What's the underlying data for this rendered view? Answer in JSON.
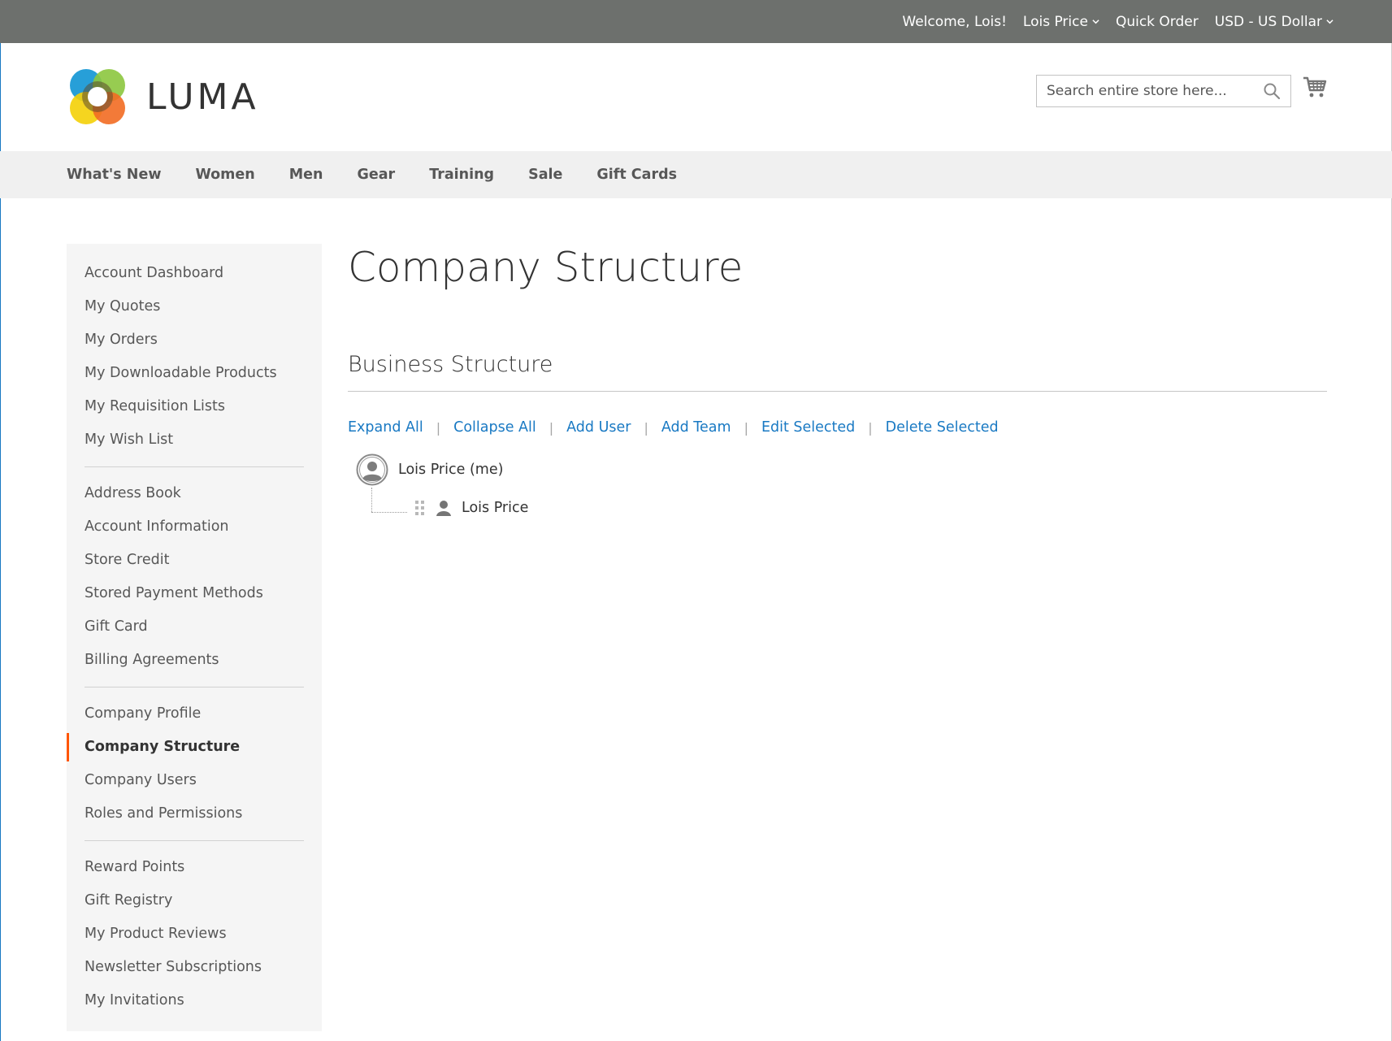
{
  "top_bar": {
    "welcome": "Welcome, Lois!",
    "account_menu": "Lois Price",
    "quick_order": "Quick Order",
    "currency": "USD - US Dollar"
  },
  "header": {
    "logo_text": "LUMA",
    "search_placeholder": "Search entire store here...",
    "search_icon": "search-icon",
    "cart_icon": "cart-icon"
  },
  "nav": {
    "items": [
      "What's New",
      "Women",
      "Men",
      "Gear",
      "Training",
      "Sale",
      "Gift Cards"
    ]
  },
  "sidebar": {
    "groups": [
      [
        "Account Dashboard",
        "My Quotes",
        "My Orders",
        "My Downloadable Products",
        "My Requisition Lists",
        "My Wish List"
      ],
      [
        "Address Book",
        "Account Information",
        "Store Credit",
        "Stored Payment Methods",
        "Gift Card",
        "Billing Agreements"
      ],
      [
        "Company Profile",
        "Company Structure",
        "Company Users",
        "Roles and Permissions"
      ],
      [
        "Reward Points",
        "Gift Registry",
        "My Product Reviews",
        "Newsletter Subscriptions",
        "My Invitations"
      ]
    ],
    "active": "Company Structure"
  },
  "main": {
    "page_title": "Company Structure",
    "section_title": "Business Structure",
    "actions": {
      "expand_all": "Expand All",
      "collapse_all": "Collapse All",
      "add_user": "Add User",
      "add_team": "Add Team",
      "edit_selected": "Edit Selected",
      "delete_selected": "Delete Selected"
    },
    "tree": {
      "root_label": "Lois Price (me)",
      "child_label": "Lois Price"
    }
  },
  "colors": {
    "top_bar_bg": "#6d706d",
    "nav_bg": "#f0f0f0",
    "sidebar_bg": "#f5f5f5",
    "link": "#1979c3",
    "active_marker": "#ff5501"
  }
}
